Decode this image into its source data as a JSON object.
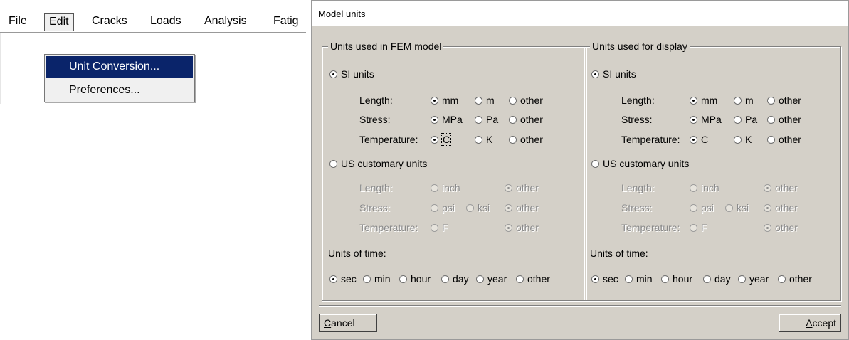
{
  "menu": {
    "items": [
      "File",
      "Edit",
      "Cracks",
      "Loads",
      "Analysis",
      "Fatig"
    ],
    "dropdown": [
      "Unit Conversion...",
      "Preferences..."
    ]
  },
  "dialog": {
    "title": "Model units",
    "left": {
      "legend": "Units used in FEM model",
      "si_label": "SI units",
      "length_label": "Length:",
      "stress_label": "Stress:",
      "temperature_label": "Temperature:",
      "si_length": [
        "mm",
        "m",
        "other"
      ],
      "si_stress": [
        "MPa",
        "Pa",
        "other"
      ],
      "si_temp": [
        "C",
        "K",
        "other"
      ],
      "us_label": "US customary units",
      "us_length": [
        "inch",
        "other"
      ],
      "us_stress": [
        "psi",
        "ksi",
        "other"
      ],
      "us_temp": [
        "F",
        "other"
      ],
      "time_label": "Units of time:",
      "time": [
        "sec",
        "min",
        "hour",
        "day",
        "year",
        "other"
      ]
    },
    "right": {
      "legend": "Units used for display",
      "si_label": "SI units",
      "length_label": "Length:",
      "stress_label": "Stress:",
      "temperature_label": "Temperature:",
      "si_length": [
        "mm",
        "m",
        "other"
      ],
      "si_stress": [
        "MPa",
        "Pa",
        "other"
      ],
      "si_temp": [
        "C",
        "K",
        "other"
      ],
      "us_label": "US customary units",
      "us_length": [
        "inch",
        "other"
      ],
      "us_stress": [
        "psi",
        "ksi",
        "other"
      ],
      "us_temp": [
        "F",
        "other"
      ],
      "time_label": "Units of time:",
      "time": [
        "sec",
        "min",
        "hour",
        "day",
        "year",
        "other"
      ]
    },
    "buttons": {
      "cancel_u": "C",
      "cancel_rest": "ancel",
      "accept_u": "A",
      "accept_rest": "ccept"
    }
  }
}
